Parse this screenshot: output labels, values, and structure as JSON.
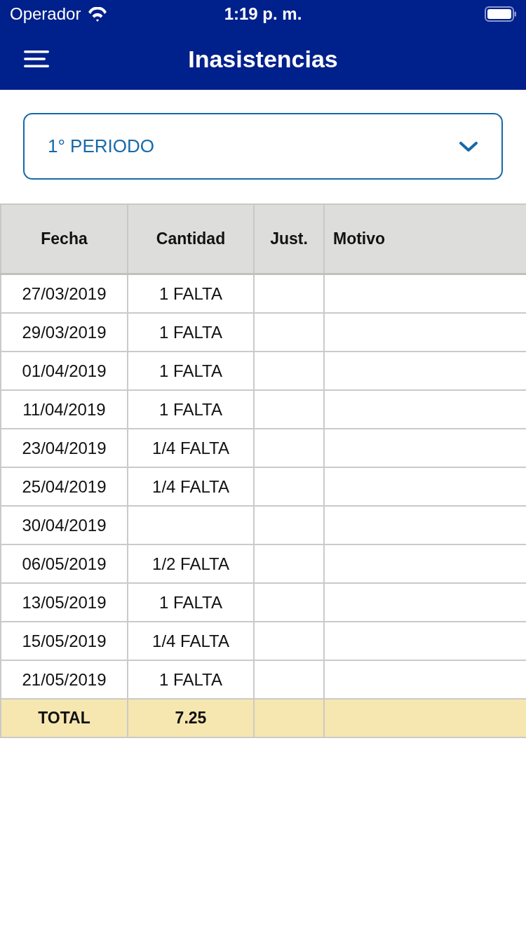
{
  "status_bar": {
    "carrier": "Operador",
    "time": "1:19 p. m."
  },
  "nav_bar": {
    "title": "Inasistencias"
  },
  "period_select": {
    "value": "1° PERIODO"
  },
  "table": {
    "columns": [
      "Fecha",
      "Cantidad",
      "Just.",
      "Motivo"
    ],
    "rows": [
      {
        "fecha": "27/03/2019",
        "cantidad": "1 FALTA"
      },
      {
        "fecha": "29/03/2019",
        "cantidad": "1 FALTA"
      },
      {
        "fecha": "01/04/2019",
        "cantidad": "1 FALTA"
      },
      {
        "fecha": "11/04/2019",
        "cantidad": "1 FALTA"
      },
      {
        "fecha": "23/04/2019",
        "cantidad": "1/4 FALTA"
      },
      {
        "fecha": "25/04/2019",
        "cantidad": "1/4 FALTA"
      },
      {
        "fecha": "30/04/2019"
      },
      {
        "fecha": "06/05/2019",
        "cantidad": "1/2 FALTA"
      },
      {
        "fecha": "13/05/2019",
        "cantidad": "1 FALTA"
      },
      {
        "fecha": "15/05/2019",
        "cantidad": "1/4 FALTA"
      },
      {
        "fecha": "21/05/2019",
        "cantidad": "1 FALTA"
      }
    ],
    "total": {
      "label": "TOTAL",
      "value": "7.25"
    }
  }
}
